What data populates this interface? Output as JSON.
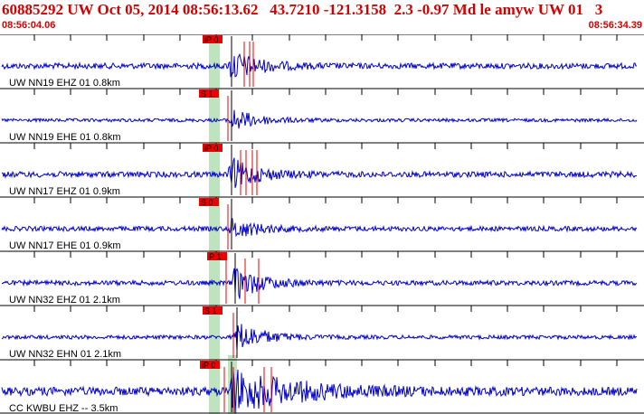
{
  "header": {
    "title": "60885292 UW Oct 05, 2014 08:56:13.62   43.7210 -121.3158  2.3 -0.97 Md le amyw UW 01   3",
    "start_time": "08:56:04.06",
    "end_time": "08:56:34.39"
  },
  "colors": {
    "title": "#d40000",
    "trace": "#0000cc",
    "pick_box": "#ee0000",
    "pick_window": "#bfe3bf",
    "grid": "#000000"
  },
  "traces": [
    {
      "label": "UW NN19 EHZ 01 0.8km",
      "pick": "iP 0",
      "amp": 0.75,
      "noise": 0.12
    },
    {
      "label": "UW NN19 EHE 01 0.8km",
      "pick": "S 1",
      "amp": 0.55,
      "noise": 0.07
    },
    {
      "label": "UW NN17 EHZ 01 0.9km",
      "pick": "iP 0",
      "amp": 0.75,
      "noise": 0.12
    },
    {
      "label": "UW NN17 EHE 01 0.9km",
      "pick": "S 0",
      "amp": 0.5,
      "noise": 0.1
    },
    {
      "label": "UW NN32 EHZ 01 2.1km",
      "pick": "P 1",
      "amp": 0.8,
      "noise": 0.1
    },
    {
      "label": "UW NN32 EHN 01 2.1km",
      "pick": "S 1",
      "amp": 0.75,
      "noise": 0.08
    },
    {
      "label": "CC KWBU EHZ -- 3.5km",
      "pick": "iP 0",
      "amp": 0.95,
      "noise": 0.18
    }
  ]
}
